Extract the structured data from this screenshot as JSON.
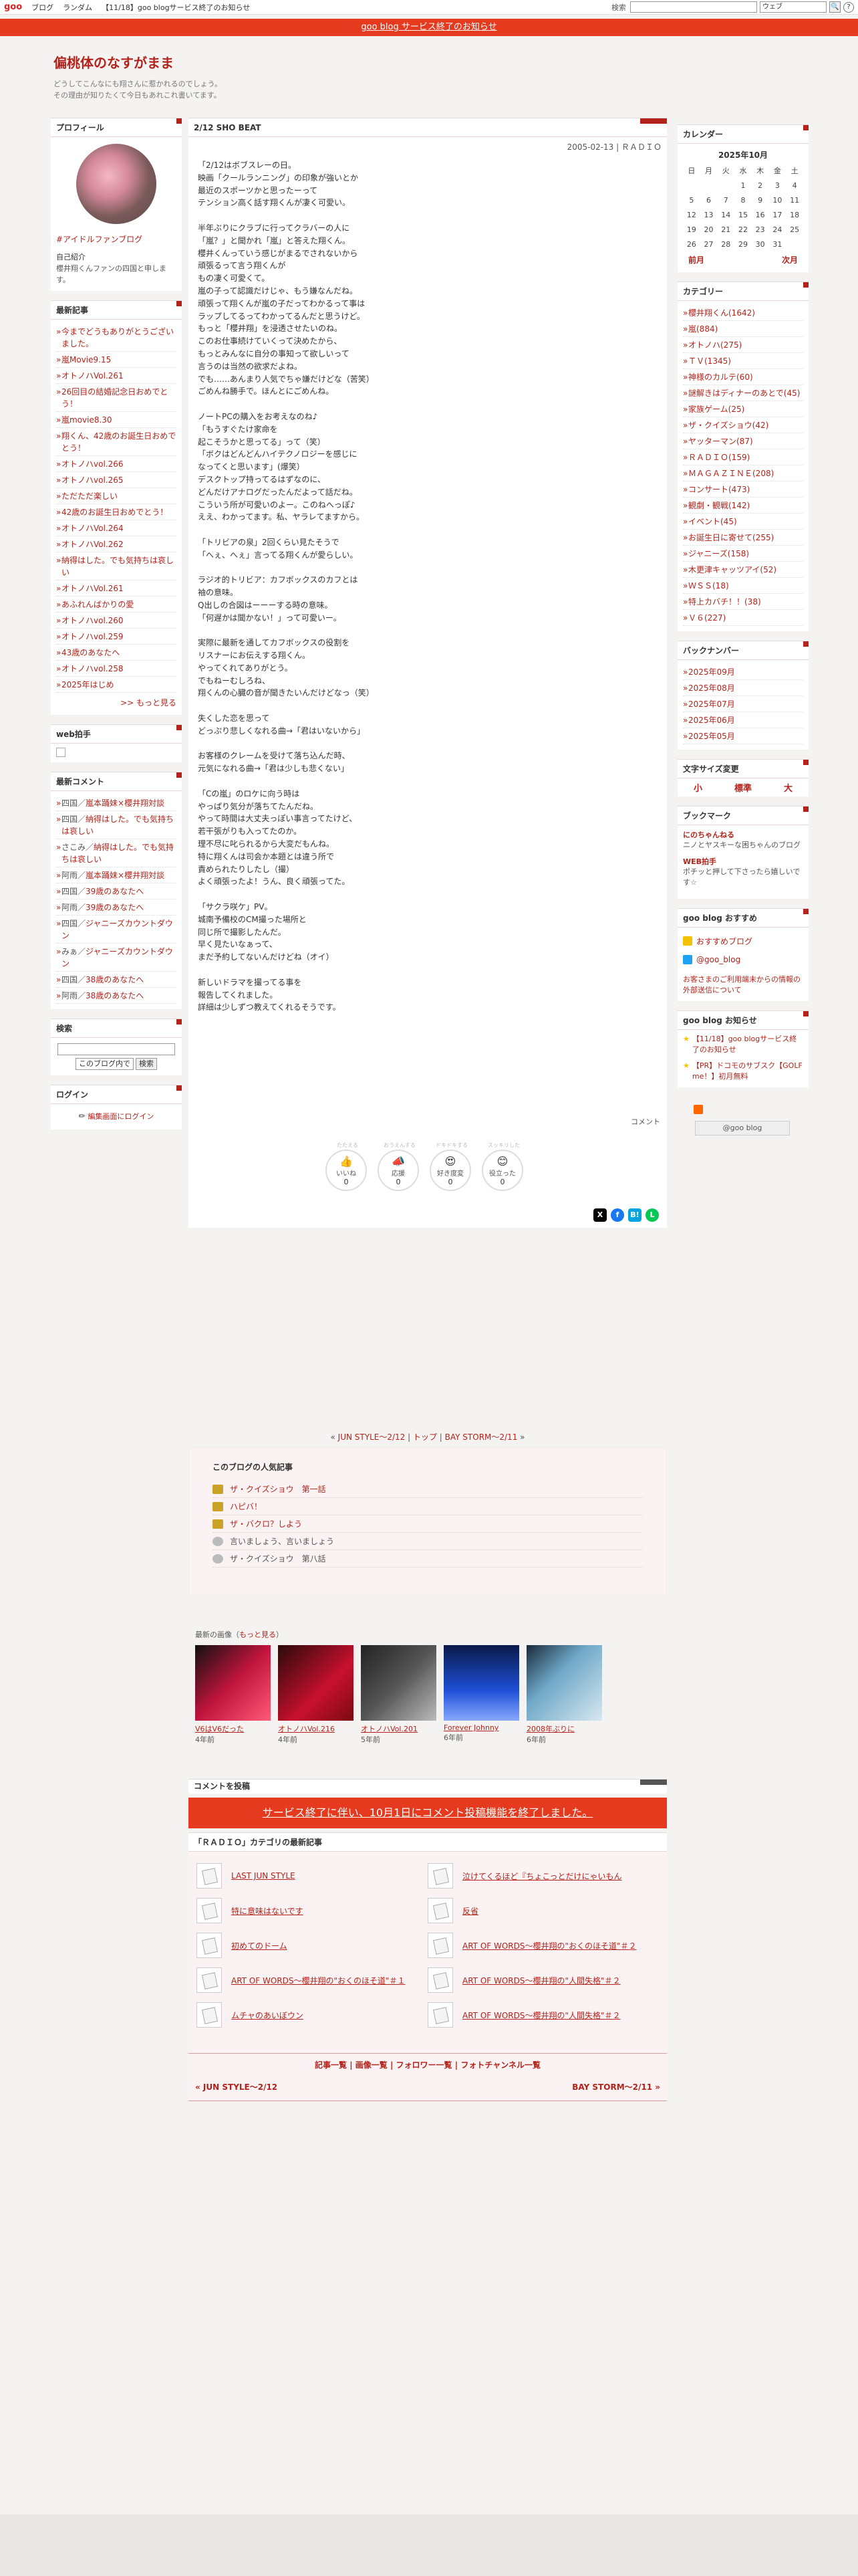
{
  "topbar": {
    "logo": "goo",
    "links": [
      "ブログ",
      "ランダム",
      "【11/18】goo blogサービス終了のお知らせ"
    ],
    "search_label": "検索",
    "search_select": "ウェブ",
    "search_go": "🔍"
  },
  "notice": "goo blog サービス終了のお知らせ",
  "blog": {
    "title": "偏桃体のなすがまま",
    "desc1": "どうしてこんなにも翔さんに惹かれるのでしょう。",
    "desc2": "その理由が知りたくて今日もあれこれ書いてます。"
  },
  "profile": {
    "title": "プロフィール",
    "tag": "#アイドルファンブログ",
    "intro_h": "自己紹介",
    "intro": "櫻井翔くんファンの四国と申します。"
  },
  "recent_posts": {
    "title": "最新記事",
    "items": [
      "今までどうもありがとうございました。",
      "嵐Movie9.15",
      "オトノハVol.261",
      "26回目の結婚記念日おめでとう！",
      "嵐movie8.30",
      "翔くん、42歳のお誕生日おめでとう！",
      "オトノハvol.266",
      "オトノハvol.265",
      "ただただ楽しい",
      "42歳のお誕生日おめでとう！",
      "オトノハVol.264",
      "オトノハVol.262",
      "納得はした。でも気持ちは哀しい",
      "オトノハVol.261",
      "あふれんばかりの愛",
      "オトノハvol.260",
      "オトノハvol.259",
      "43歳のあなたへ",
      "オトノハvol.258",
      "2025年はじめ"
    ],
    "more": ">> もっと見る"
  },
  "webhakushu": {
    "title": "web拍手"
  },
  "recent_comments": {
    "title": "最新コメント",
    "items": [
      [
        "四国",
        "嵐本踊妹×櫻井翔対談"
      ],
      [
        "四国",
        "納得はした。でも気持ちは哀しい"
      ],
      [
        "さこみ",
        "納得はした。でも気持ちは哀しい"
      ],
      [
        "阿雨",
        "嵐本踊妹×櫻井翔対談"
      ],
      [
        "四国",
        "39歳のあなたへ"
      ],
      [
        "阿雨",
        "39歳のあなたへ"
      ],
      [
        "四国",
        "ジャニーズカウントダウン"
      ],
      [
        "みぁ",
        "ジャニーズカウントダウン"
      ],
      [
        "四国",
        "38歳のあなたへ"
      ],
      [
        "阿雨",
        "38歳のあなたへ"
      ]
    ]
  },
  "search": {
    "title": "検索",
    "select": "このブログ内で",
    "btn": "検索"
  },
  "login": {
    "title": "ログイン",
    "link": "編集画面にログイン"
  },
  "post": {
    "title": "2/12 SHO BEAT",
    "meta": "2005-02-13 | ＲＡＤＩＯ",
    "body": "「2/12はボブスレーの日。\n映画「クールランニング」の印象が強いとか\n最近のスポーツかと思ったーって\nテンション高く話す翔くんが凄く可愛い。\n\n半年ぶりにクラブに行ってクラバーの人に\n「嵐？」と聞かれ「嵐」と答えた翔くん。\n櫻井くんっていう感じがまるでされないから\n頑張るって言う翔くんが\nもの凄く可愛くて。\n嵐の子って認識だけじゃ、もう嫌なんだね。\n頑張って翔くんが嵐の子だってわかるって事は\nラップしてるってわかってるんだと思うけど。\nもっと「櫻井翔」を浸透させたいのね。\nこのお仕事続けていくって決めたから、\nもっとみんなに自分の事知って欲しいって\n言うのは当然の欲求だよね。\nでも……あんまり人気でちゃ嫌だけどな（苦笑）\nごめんね勝手で。ほんとにごめんね。\n\nノートPCの購入をお考えなのね♪\n「もうすぐたけ家命を\n起こそうかと思ってる」って（笑）\n「ボクはどんどんハイテクノロジーを感じに\nなってくと思います」(爆笑）\nデスクトップ持ってるはずなのに、\nどんだけアナログだったんだよって話だね。\nこういう所が可愛いのよー。このねへっぽ♪\nええ、わかってます。私、ヤラレてますから。\n\n「トリビアの泉」2回くらい見たそうで\n「へぇ、へぇ」言ってる翔くんが愛らしい。\n\nラジオ的トリビア：カフボックスのカフとは\n袖の意味。\nQ出しの合図はーーーする時の意味。\n「何遅かは聞かない！」って可愛いー。\n\n実際に最新を通してカフボックスの役割を\nリスナーにお伝えする翔くん。\nやってくれてありがとう。\nでもねーむしろね、\n翔くんの心臓の音が聞きたいんだけどなっ（笑）\n\n失くした恋を思って\nどっぷり悲しくなれる曲→「君はいないから」\n\nお客様のクレームを受けて落ち込んだ時、\n元気になれる曲→「君は少しも悲くない」\n\n「Cの嵐」のロケに向う時は\nやっぱり気分が落ちてたんだね。\nやって時間は大丈夫っぽい事言ってたけど、\n若干張がりも入ってたのか。\n理不尽に叱られるから大変だもんね。\n特に翔くんは司会か本題とは違う所で\n責められたりしたし（撮）\nよく頑張ったよ！うん、良く頑張ってた。\n\n「サクラ咲ケ」PV。\n城南予備校のCM撮った場所と\n同じ所で撮影したんだ。\n早く見たいなぁって、\nまだ予約してないんだけどね（オイ）\n\n新しいドラマを撮ってる事を\n報告してくれました。\n詳細は少しずつ教えてくれるそうです。",
    "comment": "コメント"
  },
  "reactions": [
    {
      "cap": "たたえる",
      "em": "👍",
      "label": "いいね",
      "n": "0"
    },
    {
      "cap": "おうえんする",
      "em": "📣",
      "label": "応援",
      "n": "0"
    },
    {
      "cap": "ドキドキする",
      "em": "😍",
      "label": "好き度変",
      "n": "0"
    },
    {
      "cap": "スッキリした",
      "em": "😊",
      "label": "役立った",
      "n": "0"
    }
  ],
  "pager": {
    "prev": "JUN STYLE〜2/12",
    "top": "トップ",
    "next": "BAY STORM〜2/11"
  },
  "popular": {
    "title": "このブログの人気記事",
    "items": [
      "ザ・クイズショウ　第一話",
      "ハピバ！",
      "ザ・バクロ？しよう",
      "言いましょう、言いましょう",
      "ザ・クイズショウ　第八話"
    ]
  },
  "recent_images": {
    "title": "最新の画像",
    "more": "もっと見る",
    "items": [
      {
        "t": "V6はV6だった",
        "ago": "4年前"
      },
      {
        "t": "オトノハVol.216",
        "ago": "4年前"
      },
      {
        "t": "オトノハVol.201",
        "ago": "5年前"
      },
      {
        "t": "Forever Johnny",
        "ago": "6年前"
      },
      {
        "t": "2008年ぶりに",
        "ago": "6年前"
      }
    ]
  },
  "comment_post": {
    "title": "コメントを投稿",
    "notice": "サービス終了に伴い、10月1日にコメント投稿機能を終了しました。"
  },
  "category_posts": {
    "title": "「ＲＡＤＩＯ」カテゴリの最新記事",
    "items": [
      "LAST JUN STYLE",
      "泣けてくるほど『ちょこっとだけにゃいもん",
      "特に意味はないです",
      "反省",
      "初めてのドーム",
      "ART OF WORDS〜櫻井翔の\"おくのほそ道\"＃２",
      "ART OF WORDS〜櫻井翔の\"おくのほそ道\"＃１",
      "ART OF WORDS〜櫻井翔の\"人間失格\"＃２",
      "ムチャのあいぼウン",
      "ART OF WORDS〜櫻井翔の\"人間失格\"＃２"
    ]
  },
  "footnav": {
    "links": [
      "記事一覧",
      "画像一覧",
      "フォロワー一覧",
      "フォトチャンネル一覧"
    ],
    "prev": "« JUN STYLE〜2/12",
    "next": "BAY STORM〜2/11 »"
  },
  "calendar": {
    "title": "カレンダー",
    "month": "2025年10月",
    "days": [
      "日",
      "月",
      "火",
      "水",
      "木",
      "金",
      "土"
    ],
    "weeks": [
      [
        "",
        "",
        "",
        "1",
        "2",
        "3",
        "4"
      ],
      [
        "5",
        "6",
        "7",
        "8",
        "9",
        "10",
        "11"
      ],
      [
        "12",
        "13",
        "14",
        "15",
        "16",
        "17",
        "18"
      ],
      [
        "19",
        "20",
        "21",
        "22",
        "23",
        "24",
        "25"
      ],
      [
        "26",
        "27",
        "28",
        "29",
        "30",
        "31",
        ""
      ]
    ],
    "prev": "前月",
    "next": "次月"
  },
  "categories": {
    "title": "カテゴリー",
    "items": [
      "櫻井翔くん(1642)",
      "嵐(884)",
      "オトノハ(275)",
      "ＴＶ(1345)",
      "神様のカルテ(60)",
      "謎解きはディナーのあとで(45)",
      "家族ゲーム(25)",
      "ザ・クイズショウ(42)",
      "ヤッターマン(87)",
      "ＲＡＤＩＯ(159)",
      "ＭＡＧＡＺＩＮＥ(208)",
      "コンサート(473)",
      "観劇・観戦(142)",
      "イベント(45)",
      "お誕生日に寄せて(255)",
      "ジャニーズ(158)",
      "木更津キャッツアイ(52)",
      "ＷＳＳ(18)",
      "特上カバチ！！(38)",
      "Ｖ６(227)"
    ]
  },
  "backnumber": {
    "title": "バックナンバー",
    "items": [
      "2025年09月",
      "2025年08月",
      "2025年07月",
      "2025年06月",
      "2025年05月"
    ]
  },
  "fontsize": {
    "title": "文字サイズ変更",
    "items": [
      "小",
      "標準",
      "大"
    ]
  },
  "bookmark": {
    "title": "ブックマーク",
    "items": [
      {
        "t": "にのちゃんねる",
        "d": "ニノとヤスキーな困ちゃんのブログ"
      },
      {
        "t": "WEB拍手",
        "d": "ポチッと押して下さったら嬉しいです☆"
      }
    ]
  },
  "goo_recommend": {
    "title": "goo blog おすすめ",
    "items": [
      "おすすめブログ",
      "@goo_blog"
    ],
    "note": "お客さまのご利用端末からの情報の外部送信について"
  },
  "goo_notice": {
    "title": "goo blog お知らせ",
    "items": [
      "【11/18】goo blogサービス終了のお知らせ",
      "【PR】ドコモのサブスク【GOLF me！】初月無料"
    ]
  },
  "goo_btn": "@goo blog",
  "colors": {
    "accent": "#b3231b",
    "notice": "#e53a1e"
  }
}
